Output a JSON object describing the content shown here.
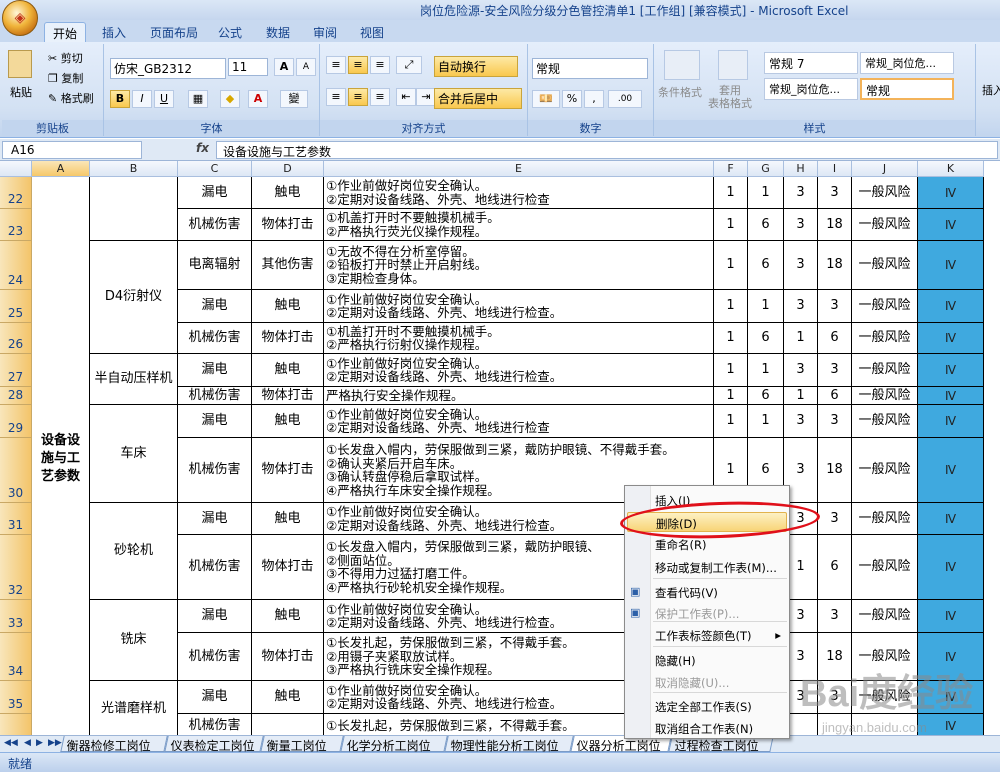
{
  "window": {
    "title": "岗位危险源-安全风险分级分色管控清单1 [工作组] [兼容模式] - Microsoft Excel"
  },
  "tabs": [
    "开始",
    "插入",
    "页面布局",
    "公式",
    "数据",
    "审阅",
    "视图"
  ],
  "ribbon": {
    "clipboard": {
      "paste": "粘贴",
      "cut": "剪切",
      "copy": "复制",
      "format_painter": "格式刷",
      "label": "剪贴板"
    },
    "font": {
      "name": "仿宋_GB2312",
      "size": "11",
      "grow": "A",
      "shrink": "A",
      "bold": "B",
      "italic": "I",
      "underline": "U",
      "label": "字体",
      "phonetic": "變"
    },
    "align": {
      "wrap": "自动换行",
      "merge": "合并后居中",
      "label": "对齐方式"
    },
    "number": {
      "format": "常规",
      "percent": "%",
      "comma": ",",
      "dec_inc": ".00",
      "label": "数字"
    },
    "styles": {
      "cond": "条件格式",
      "table": "套用\n表格格式",
      "cells": [
        "常规 7",
        "常规_岗位危...",
        "常规_岗位危...",
        "常规"
      ],
      "label": "样式"
    },
    "insert": "插入"
  },
  "formula_bar": {
    "name_box": "A16",
    "fx": "fx",
    "value": "设备设施与工艺参数"
  },
  "columns": [
    "A",
    "B",
    "C",
    "D",
    "E",
    "F",
    "G",
    "H",
    "I",
    "J",
    "K"
  ],
  "rows": [
    {
      "num": "22",
      "c": "漏电",
      "d": "触电",
      "e": "①作业前做好岗位安全确认。\n②定期对设备线路、外壳、地线进行检查",
      "f": "1",
      "g": "1",
      "h": "3",
      "i": "3",
      "j": "一般风险",
      "k": "Ⅳ"
    },
    {
      "num": "23",
      "c": "机械伤害",
      "d": "物体打击",
      "e": "①机盖打开时不要触摸机械手。\n②严格执行荧光仪操作规程。",
      "f": "1",
      "g": "6",
      "h": "3",
      "i": "18",
      "j": "一般风险",
      "k": "Ⅳ"
    },
    {
      "num": "24",
      "c": "电离辐射",
      "d": "其他伤害",
      "e": "①无故不得在分析室停留。\n②铅板打开时禁止开启射线。\n③定期检查身体。",
      "f": "1",
      "g": "6",
      "h": "3",
      "i": "18",
      "j": "一般风险",
      "k": "Ⅳ"
    },
    {
      "num": "25",
      "c": "漏电",
      "d": "触电",
      "e": "①作业前做好岗位安全确认。\n②定期对设备线路、外壳、地线进行检查。",
      "f": "1",
      "g": "1",
      "h": "3",
      "i": "3",
      "j": "一般风险",
      "k": "Ⅳ"
    },
    {
      "num": "26",
      "c": "机械伤害",
      "d": "物体打击",
      "e": "①机盖打开时不要触摸机械手。\n②严格执行衍射仪操作规程。",
      "f": "1",
      "g": "6",
      "h": "1",
      "i": "6",
      "j": "一般风险",
      "k": "Ⅳ"
    },
    {
      "num": "27",
      "c": "漏电",
      "d": "触电",
      "e": "①作业前做好岗位安全确认。\n②定期对设备线路、外壳、地线进行检查。",
      "f": "1",
      "g": "1",
      "h": "3",
      "i": "3",
      "j": "一般风险",
      "k": "Ⅳ"
    },
    {
      "num": "28",
      "c": "机械伤害",
      "d": "物体打击",
      "e": "严格执行安全操作规程。",
      "f": "1",
      "g": "6",
      "h": "1",
      "i": "6",
      "j": "一般风险",
      "k": "Ⅳ"
    },
    {
      "num": "29",
      "c": "漏电",
      "d": "触电",
      "e": "①作业前做好岗位安全确认。\n②定期对设备线路、外壳、地线进行检查",
      "f": "1",
      "g": "1",
      "h": "3",
      "i": "3",
      "j": "一般风险",
      "k": "Ⅳ"
    },
    {
      "num": "30",
      "c": "机械伤害",
      "d": "物体打击",
      "e": "①长发盘入帽内，劳保服做到三紧，戴防护眼镜、不得戴手套。\n②确认夹紧后开启车床。\n③确认转盘停稳后拿取试样。\n④严格执行车床安全操作规程。",
      "f": "1",
      "g": "6",
      "h": "3",
      "i": "18",
      "j": "一般风险",
      "k": "Ⅳ"
    },
    {
      "num": "31",
      "c": "漏电",
      "d": "触电",
      "e": "①作业前做好岗位安全确认。\n②定期对设备线路、外壳、地线进行检查。",
      "f": "",
      "g": "",
      "h": "3",
      "i": "3",
      "j": "一般风险",
      "k": "Ⅳ"
    },
    {
      "num": "32",
      "c": "机械伤害",
      "d": "物体打击",
      "e": "①长发盘入帽内，劳保服做到三紧，戴防护眼镜、\n②侧面站位。\n③不得用力过猛打磨工件。\n④严格执行砂轮机安全操作规程。",
      "f": "",
      "g": "",
      "h": "1",
      "i": "6",
      "j": "一般风险",
      "k": "Ⅳ"
    },
    {
      "num": "33",
      "c": "漏电",
      "d": "触电",
      "e": "①作业前做好岗位安全确认。\n②定期对设备线路、外壳、地线进行检查。",
      "f": "",
      "g": "",
      "h": "3",
      "i": "3",
      "j": "一般风险",
      "k": "Ⅳ"
    },
    {
      "num": "34",
      "c": "机械伤害",
      "d": "物体打击",
      "e": "①长发扎起，劳保服做到三紧，不得戴手套。\n②用镊子夹紧取放试样。\n③严格执行铣床安全操作规程。",
      "f": "",
      "g": "",
      "h": "3",
      "i": "18",
      "j": "一般风险",
      "k": "Ⅳ"
    },
    {
      "num": "35",
      "c": "漏电",
      "d": "触电",
      "e": "①作业前做好岗位安全确认。\n②定期对设备线路、外壳、地线进行检查。",
      "f": "",
      "g": "",
      "h": "3",
      "i": "3",
      "j": "一般风险",
      "k": "Ⅳ"
    },
    {
      "num": "",
      "c": "机械伤害",
      "d": "",
      "e": "①长发扎起，劳保服做到三紧，不得戴手套。",
      "f": "",
      "g": "",
      "h": "",
      "i": "",
      "j": "",
      "k": "Ⅳ"
    }
  ],
  "col_a_label": "设备设\n施与工\n艺参数",
  "col_b_groups": [
    "D4衍射仪",
    "半自动压样机",
    "车床",
    "砂轮机",
    "铣床",
    "光谱磨样机"
  ],
  "sheet_tabs": [
    "衡器检修工岗位",
    "仪表检定工岗位",
    "衡量工岗位",
    "化学分析工岗位",
    "物理性能分析工岗位",
    "仪器分析工岗位",
    "过程检查工岗位"
  ],
  "status": "就绪",
  "context_menu": {
    "items": [
      {
        "label": "插入(I)...",
        "disabled": false
      },
      {
        "label": "删除(D)",
        "disabled": false,
        "highlight": true
      },
      {
        "label": "重命名(R)",
        "disabled": false
      },
      {
        "label": "移动或复制工作表(M)...",
        "disabled": false
      },
      {
        "label": "查看代码(V)",
        "disabled": false
      },
      {
        "label": "保护工作表(P)...",
        "disabled": true
      },
      {
        "label": "工作表标签颜色(T)",
        "disabled": false,
        "arrow": "▸"
      },
      {
        "label": "隐藏(H)",
        "disabled": false
      },
      {
        "label": "取消隐藏(U)...",
        "disabled": true
      },
      {
        "label": "选定全部工作表(S)",
        "disabled": false
      },
      {
        "label": "取消组合工作表(N)",
        "disabled": false
      }
    ]
  },
  "watermark": {
    "brand": "Bai度经验",
    "url": "jingyan.baidu.com"
  },
  "colors": {
    "accent_blue": "#3fa9df",
    "row_header": "#f3c46a",
    "ring": "#e0101a"
  }
}
